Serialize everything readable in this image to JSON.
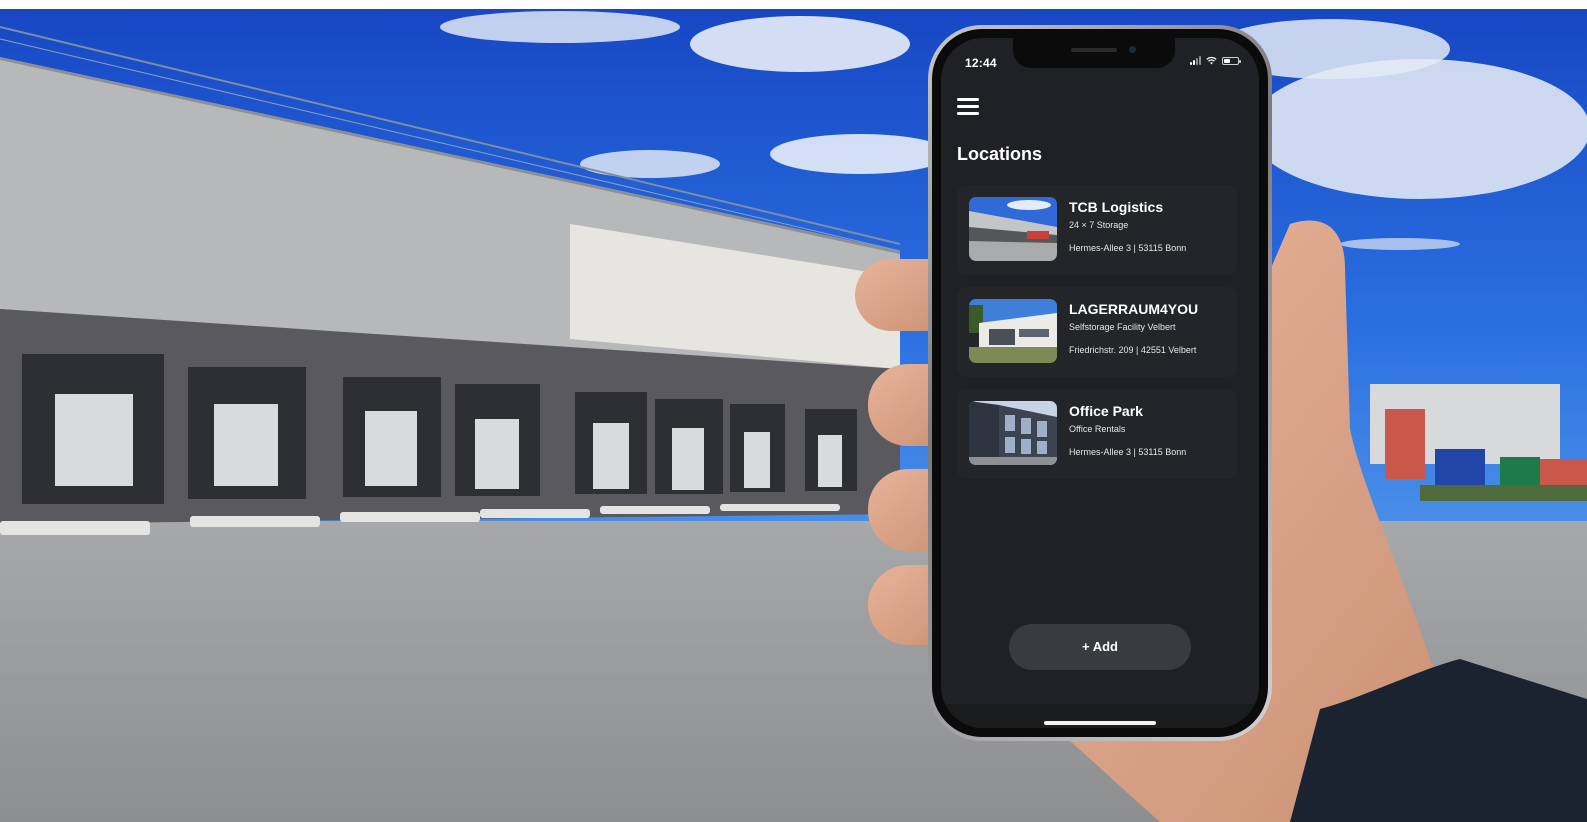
{
  "status_bar": {
    "time": "12:44",
    "icons": [
      "cellular-signal-icon",
      "wifi-icon",
      "battery-icon"
    ]
  },
  "header": {
    "menu_icon": "hamburger-menu-icon",
    "title": "Locations"
  },
  "locations": [
    {
      "name": "TCB Logistics",
      "subtitle": "24 × 7 Storage",
      "address": "Hermes-Allee 3 | 53115 Bonn",
      "thumbnail": "warehouse-photo"
    },
    {
      "name": "LAGERRAUM4YOU",
      "subtitle": "Selfstorage Facility Velbert",
      "address": "Friedrichstr. 209 | 42551 Velbert",
      "thumbnail": "storage-building-photo"
    },
    {
      "name": "Office Park",
      "subtitle": "Office Rentals",
      "address": "Hermes-Allee 3 | 53115 Bonn",
      "thumbnail": "office-building-photo"
    }
  ],
  "actions": {
    "add_label": "+ Add"
  },
  "colors": {
    "screen_background": "#202124",
    "card_background": "#242528",
    "button_background": "#3a3b3e",
    "sky": "#1f5fd6"
  }
}
